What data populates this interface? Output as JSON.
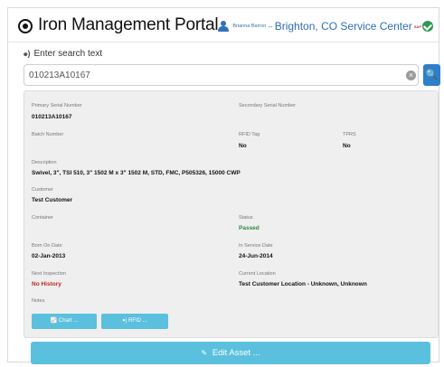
{
  "header": {
    "brand_icon": "target-icon",
    "title": "Iron Management Portal",
    "user_icon": "user-icon",
    "user_name": "Brianna Barron",
    "separator": "--",
    "location": "Brighton, CO Service Center",
    "flag": "SAP",
    "status_icon": "check-circle-icon"
  },
  "search": {
    "label_icon": "rss-icon",
    "label": "Enter search text",
    "value": "010213A10167",
    "clear_icon": "clear-icon",
    "button_icon": "search-icon",
    "button_glyph": "🔍"
  },
  "asset": {
    "primary_serial": {
      "label": "Primary Serial Number",
      "value": "010213A10167"
    },
    "secondary_serial": {
      "label": "Secondary Serial Number",
      "value": ""
    },
    "batch_number": {
      "label": "Batch Number",
      "value": ""
    },
    "rfid_tag": {
      "label": "RFID Tag",
      "value": "No"
    },
    "tpms": {
      "label": "TPRS",
      "value": "No"
    },
    "description": {
      "label": "Description",
      "value": "Swivel, 3\", TSI 510, 3\" 1502 M x 3\" 1502 M, STD, FMC, P505326, 15000 CWP"
    },
    "customer": {
      "label": "Customer",
      "value": "Test Customer"
    },
    "container": {
      "label": "Container",
      "value": ""
    },
    "status": {
      "label": "Status",
      "value": "Passed"
    },
    "born_on_date": {
      "label": "Born On Date",
      "value": "02-Jan-2013"
    },
    "in_service_date": {
      "label": "In Service Date",
      "value": "24-Jun-2014"
    },
    "next_inspection": {
      "label": "Next Inspection",
      "value": "No History"
    },
    "current_location": {
      "label": "Current Location",
      "value": "Test Customer Location - Unknown, Unknown"
    },
    "notes": {
      "label": "Notes",
      "value": ""
    }
  },
  "actions": {
    "chart_label": "Chart ...",
    "chart_icon": "chart-icon",
    "rfid_label": "RFID ...",
    "rfid_icon": "rss-icon",
    "edit_label": "Edit Asset ...",
    "edit_icon": "edit-icon"
  },
  "colors": {
    "accent": "#5bc0de",
    "primary": "#2d7fc9",
    "status_passed": "#2e8a3e",
    "status_alert": "#c0261f"
  }
}
